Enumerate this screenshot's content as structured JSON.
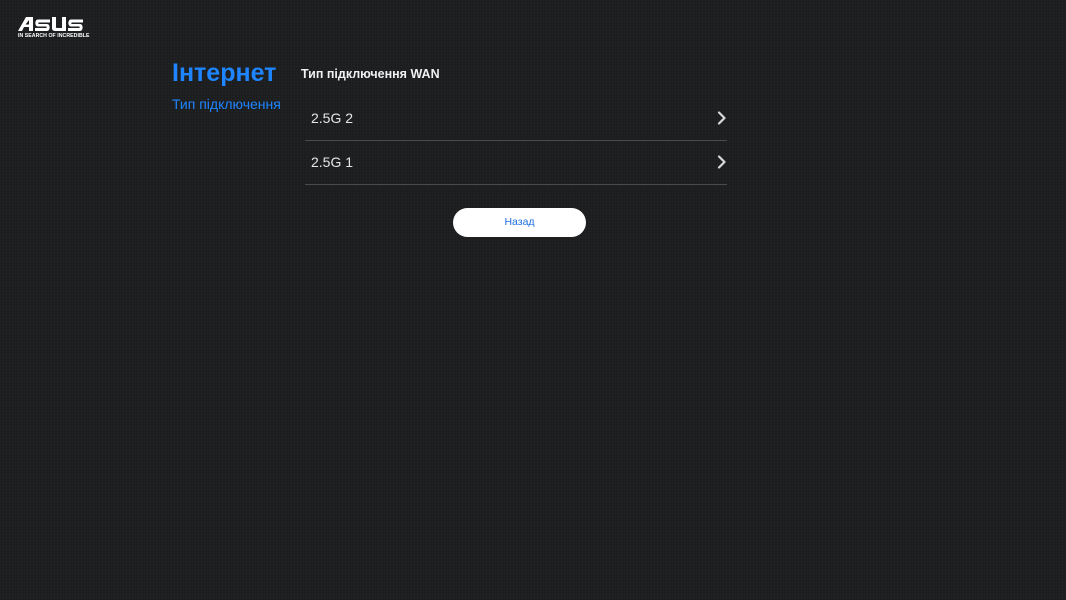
{
  "brand": {
    "logo_text": "ASUS",
    "tagline": "IN SEARCH OF INCREDIBLE"
  },
  "sidebar": {
    "title": "Інтернет",
    "subtitle": "Тип підключення"
  },
  "main": {
    "section_title": "Тип підключення WAN",
    "options": [
      {
        "label": "2.5G 2",
        "icon": "chevron-right-icon"
      },
      {
        "label": "2.5G 1",
        "icon": "chevron-right-icon"
      }
    ],
    "back_label": "Назад"
  },
  "colors": {
    "background": "#1c1d1f",
    "accent": "#1e85ff",
    "divider": "#4a4b4d",
    "button_bg": "#ffffff",
    "button_text": "#1e6fe0"
  }
}
